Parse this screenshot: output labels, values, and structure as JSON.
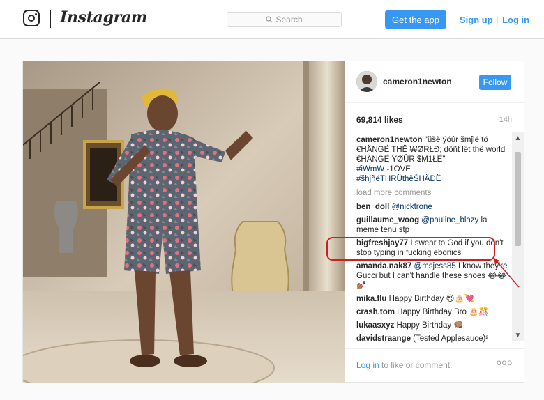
{
  "header": {
    "brand": "Instagram",
    "search_placeholder": "Search",
    "get_app_label": "Get the app",
    "signup_label": "Sign up",
    "login_label": "Log in",
    "separator": "|"
  },
  "post": {
    "username": "cameron1newton",
    "follow_label": "Follow",
    "likes": "69,814 likes",
    "time_ago": "14h",
    "caption": {
      "user": "cameron1newton",
      "text": "\"ŭšě ÿöûr šmĵlë tö €HÄNGË THË ₩ØRŁÐ; döñt lët thë world €HÄNGË ŸØÛR $M1ŁË\"",
      "hashtag1": "#iWmW",
      "extra": " -1OVE",
      "hashtag2": "#šhjñëTHRÜthëŠHÄÐË"
    },
    "load_more": "load more comments",
    "comments": [
      {
        "user": "ben_doll",
        "mention": "@nicktrone",
        "text": ""
      },
      {
        "user": "guillaume_woog",
        "mention": "@pauline_blazy",
        "text": " la meme tenu stp"
      },
      {
        "user": "bigfreshjay77",
        "mention": "",
        "text": " I swear to God if you don't stop typing in fucking ebonics"
      },
      {
        "user": "amanda.nak87",
        "mention": "@msjess85",
        "text": " I know they're Gucci but I can't handle these shoes 😂😂💅🏽"
      },
      {
        "user": "mika.flu",
        "mention": "",
        "text": " Happy Birthday 😍🎂💘"
      },
      {
        "user": "crash.tom",
        "mention": "",
        "text": " Happy Birthday Bro 🎂🎊"
      },
      {
        "user": "lukaasxyz",
        "mention": "",
        "text": " Happy Birthday 👊🏽"
      },
      {
        "user": "davidstraange",
        "mention": "",
        "text": " (Tested Applesauce)²"
      }
    ],
    "footer": {
      "login_link": "Log in",
      "rest": " to like or comment.",
      "more": "ooo"
    }
  },
  "colors": {
    "accent": "#3897f0",
    "highlight": "#cc1f1f"
  },
  "icons": {
    "logo": "instagram-glyph-icon",
    "search": "search-icon",
    "more": "more-options-icon"
  }
}
